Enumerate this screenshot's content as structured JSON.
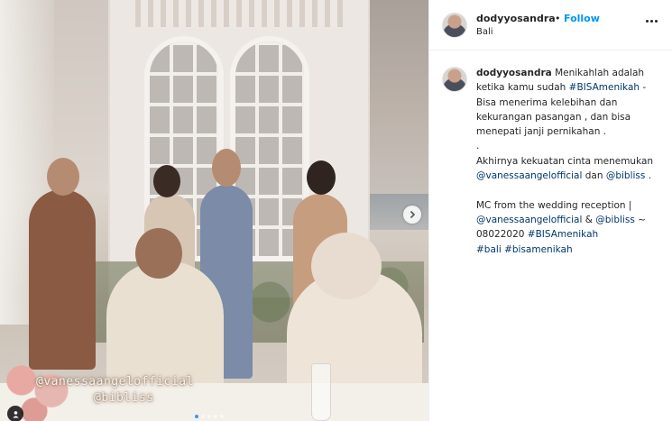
{
  "post": {
    "username": "dodyyosandra",
    "separator": "•",
    "follow_label": "Follow",
    "location": "Bali"
  },
  "media": {
    "sticker_lines": [
      "@vanessaangelofficial",
      "@bibliss"
    ],
    "carousel_dots": 5,
    "active_dot_index": 0,
    "next_icon": "chevron-right-icon",
    "tag_icon": "user-tag-icon"
  },
  "caption": {
    "username": "dodyyosandra",
    "line1_text": "Menikahlah adalah ketika kamu sudah ",
    "line1_hashtag": "#BISAmenikah",
    "line1_tail": " - Bisa menerima kelebihan dan kekurangan pasangan , dan bisa menepati janji pernikahan .",
    "dot_line": ".",
    "line2_text": "Akhirnya kekuatan cinta menemukan ",
    "line2_mention1": "@vanessaangelofficial",
    "line2_mid": " dan ",
    "line2_mention2": "@bibliss",
    "line2_tail": " .",
    "line3_text": "MC from the wedding reception | ",
    "line3_mention1": "@vanessaangelofficial",
    "line3_mid": " & ",
    "line3_mention2": "@bibliss",
    "line3_date": " ~ 08022020 ",
    "line3_hashtag": "#BISAmenikah",
    "line4_hashtag1": "#bali",
    "line4_hashtag2": "#bisamenikah"
  },
  "colors": {
    "link_blue": "#0095f6",
    "hashtag": "#00376b",
    "text": "#262626"
  }
}
